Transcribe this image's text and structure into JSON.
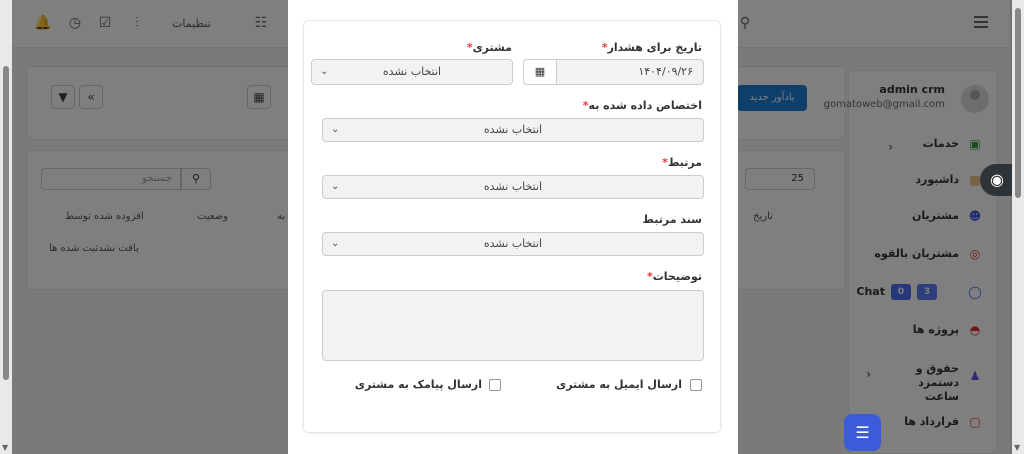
{
  "topbar": {
    "settings_label": "تنظیمات",
    "icons": [
      "bell-icon",
      "clock-icon",
      "check-square-icon",
      "share-icon",
      "id-card-icon",
      "search-icon",
      "menu-icon"
    ]
  },
  "toolbar": {
    "new_reminder_label": "یادآور جدید"
  },
  "table": {
    "page_size": "25",
    "search_placeholder": "جستجو",
    "headers": [
      "تاریخ",
      "مربوط به",
      "وضعیت",
      "افزوده شده توسط"
    ],
    "empty_text": "یافت نشدثبت شده ها"
  },
  "sidebar": {
    "user_name": "admin crm",
    "user_email": "gomatoweb@gmail.com",
    "items": [
      {
        "label": "خدمات",
        "icon": "store-icon",
        "color": "#2f9e44"
      },
      {
        "label": "داشبورد",
        "icon": "dashboard-icon",
        "color": "#e6a23c"
      },
      {
        "label": "مشتریان",
        "icon": "user-icon",
        "color": "#3b5bdb"
      },
      {
        "label": "مشتریان بالقوه",
        "icon": "target-icon",
        "color": "#e03131"
      },
      {
        "label": "Chat",
        "icon": "chat-icon",
        "color": "#3b5bdb",
        "badges": [
          "0",
          "3"
        ]
      },
      {
        "label": "پروژه ها",
        "icon": "chart-icon",
        "color": "#e03131"
      },
      {
        "label": "حقوق و دستمزد ساعت",
        "icon": "people-icon",
        "color": "#7048e8"
      },
      {
        "label": "قرارداد ها",
        "icon": "contract-icon",
        "color": "#e03131"
      }
    ]
  },
  "form": {
    "reminder_date": {
      "label": "تاریخ برای هشدار",
      "value": "۱۴۰۴/۰۹/۲۶"
    },
    "customer": {
      "label": "مشتری",
      "value": "انتخاب نشده"
    },
    "assigned_to": {
      "label": "اختصاص داده شده به",
      "value": "انتخاب نشده"
    },
    "related": {
      "label": "مرتبط",
      "value": "انتخاب نشده"
    },
    "related_doc": {
      "label": "سند مرتبط",
      "value": "انتخاب نشده"
    },
    "description": {
      "label": "توضیحات",
      "value": ""
    },
    "send_email_label": "ارسال ایمیل به مشتری",
    "send_sms_label": "ارسال پیامک به مشتری"
  },
  "colors": {
    "accent": "#1c7ed6",
    "required": "#e03a3a",
    "fab": "#3b5bdb"
  }
}
